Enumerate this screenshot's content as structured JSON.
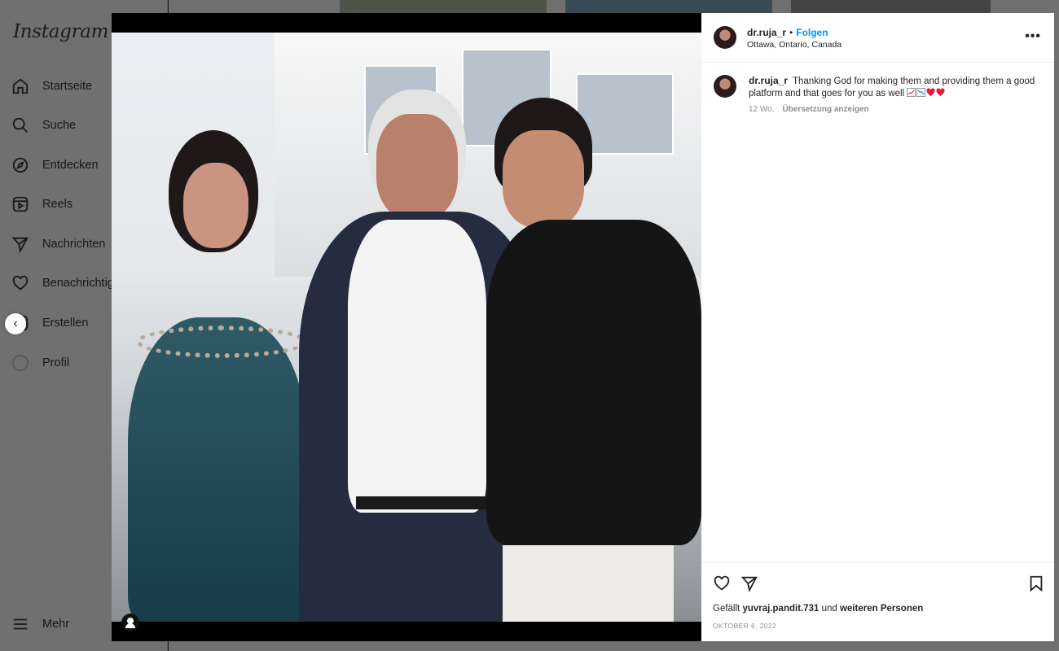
{
  "app": {
    "logo": "Instagram"
  },
  "sidebar": {
    "items": [
      {
        "label": "Startseite",
        "icon": "home-icon"
      },
      {
        "label": "Suche",
        "icon": "search-icon"
      },
      {
        "label": "Entdecken",
        "icon": "compass-icon"
      },
      {
        "label": "Reels",
        "icon": "reels-icon"
      },
      {
        "label": "Nachrichten",
        "icon": "send-icon"
      },
      {
        "label": "Benachrichtigungen",
        "icon": "heart-icon"
      },
      {
        "label": "Erstellen",
        "icon": "plus-square-icon"
      },
      {
        "label": "Profil",
        "icon": "profile-avatar-icon"
      }
    ],
    "more_label": "Mehr"
  },
  "post": {
    "username": "dr.ruja_r",
    "follow_label": "Folgen",
    "location": "Ottawa, Ontario, Canada",
    "caption_text": "Thanking God for making them and providing them a good platform and that goes for you as well",
    "caption_emojis": [
      "chart-increasing-emoji",
      "chart-decreasing-emoji",
      "red-heart-emoji",
      "red-heart-emoji"
    ],
    "time_ago": "12 Wo.",
    "translate_label": "Übersetzung anzeigen",
    "likes_prefix": "Gefällt",
    "liked_by": "yuvraj.pandit.731",
    "likes_middle": "und",
    "likes_suffix": "weiteren Personen",
    "date": "OKTOBER 6, 2022"
  },
  "colors": {
    "accent": "#0095f6",
    "overlay": "#707070",
    "heart": "#ed1c3c"
  }
}
